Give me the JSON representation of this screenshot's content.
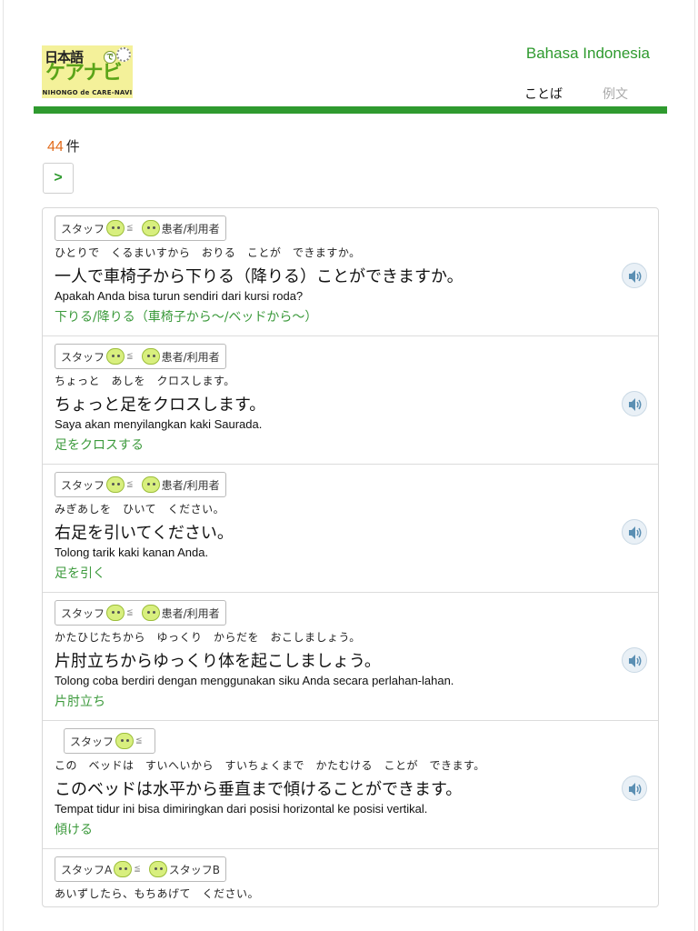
{
  "header": {
    "logo": {
      "top_text": "日本語",
      "de": "で",
      "main_text": "ケアナビ",
      "sub_text": "NIHONGO de CARE-NAVI"
    },
    "language_link": "Bahasa Indonesia",
    "tabs": [
      {
        "label": "ことば",
        "active": true
      },
      {
        "label": "例文",
        "active": false
      }
    ],
    "accent_color": "#2f9a2f"
  },
  "results": {
    "count": "44",
    "unit": "件"
  },
  "pagination": {
    "next_label": ">"
  },
  "items": [
    {
      "speaker": "スタッフ",
      "listener": "患者/利用者",
      "ruby": "ひとりで　くるまいすから　おりる　ことが　できますか。",
      "japanese": "一人で車椅子から下りる（降りる）ことができますか。",
      "indonesian": "Apakah Anda bisa turun sendiri dari kursi roda?",
      "term": "下りる/降りる（車椅子から～/ベッドから～）",
      "audio_icon": "speaker-icon"
    },
    {
      "speaker": "スタッフ",
      "listener": "患者/利用者",
      "ruby": "ちょっと　あしを　クロスします。",
      "japanese": "ちょっと足をクロスします。",
      "indonesian": "Saya akan menyilangkan kaki Saurada.",
      "term": "足をクロスする",
      "audio_icon": "speaker-icon"
    },
    {
      "speaker": "スタッフ",
      "listener": "患者/利用者",
      "ruby": "みぎあしを　ひいて　ください。",
      "japanese": "右足を引いてください。",
      "indonesian": "Tolong tarik kaki kanan Anda.",
      "term": "足を引く",
      "audio_icon": "speaker-icon"
    },
    {
      "speaker": "スタッフ",
      "listener": "患者/利用者",
      "ruby": "かたひじたちから　ゆっくり　からだを　おこしましょう。",
      "japanese": "片肘立ちからゆっくり体を起こしましょう。",
      "indonesian": "Tolong coba berdiri dengan menggunakan siku Anda secara perlahan-lahan.",
      "term": "片肘立ち",
      "audio_icon": "speaker-icon"
    },
    {
      "speaker": "スタッフ",
      "listener": "",
      "ruby": "この　ベッドは　すいへいから　すいちょくまで　かたむける　ことが　できます。",
      "japanese": "このベッドは水平から垂直まで傾けることができます。",
      "indonesian": "Tempat tidur ini bisa dimiringkan dari posisi horizontal ke posisi vertikal.",
      "term": "傾ける",
      "audio_icon": "speaker-icon"
    },
    {
      "speaker": "スタッフA",
      "listener": "スタッフB",
      "ruby": "あいずしたら、もちあげて　ください。",
      "japanese": "",
      "indonesian": "",
      "term": "",
      "audio_icon": ""
    }
  ]
}
